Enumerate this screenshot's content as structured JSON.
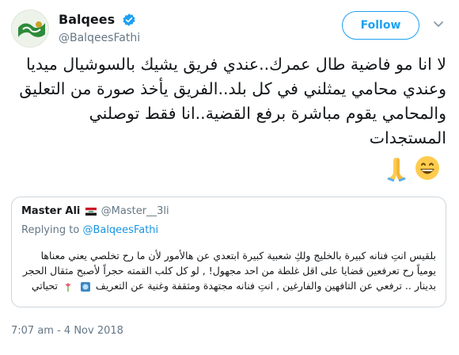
{
  "author": {
    "display_name": "Balqees",
    "handle": "@BalqeesFathi",
    "verified": true,
    "avatar_icon": "green-flag-avatar"
  },
  "follow_label": "Follow",
  "tweet": {
    "text": "لا انا مو فاضية طال عمرك..عندي فريق يشيك بالسوشيال ميديا وعندي محامي يمثلني في كل بلد..الفريق يأخذ صورة من التعليق والمحامي يقوم مباشرة برفع القضية..انا فقط توصلني المستجدات",
    "emojis": [
      "grinning-face-emoji",
      "folded-hands-emoji"
    ]
  },
  "quoted_tweet": {
    "name": "Master Ali",
    "flag_icon": "iraq-flag-icon",
    "handle": "@Master__3li",
    "replying_prefix": "Replying to",
    "replying_to": "@BalqeesFathi",
    "text": "بلقيس انتِ فنانه كبيرة بالخليج ولكِ شعبية كبيرة ابتعدي عن هالأمور لأن ما رح تخلصي يعني معناها يومياً رح تعرفعين قضايا على اقل غلطة من احد مجهول! , لو كل كلب القمته حجراً لأصبح مثقال الحجر بدينار .. ترفعي عن التافهين والفارغين , انتِ فنانه مجتهدة ومثقفة وغنية عن التعريف",
    "trailing_text": "تحياتي",
    "emojis": [
      "blue-ornament-emoji",
      "tulip-emoji"
    ]
  },
  "timestamp": "7:07 am - 4 Nov 2018",
  "colors": {
    "accent": "#1da1f2",
    "secondary_text": "#657786",
    "border": "#ccd6dd"
  }
}
